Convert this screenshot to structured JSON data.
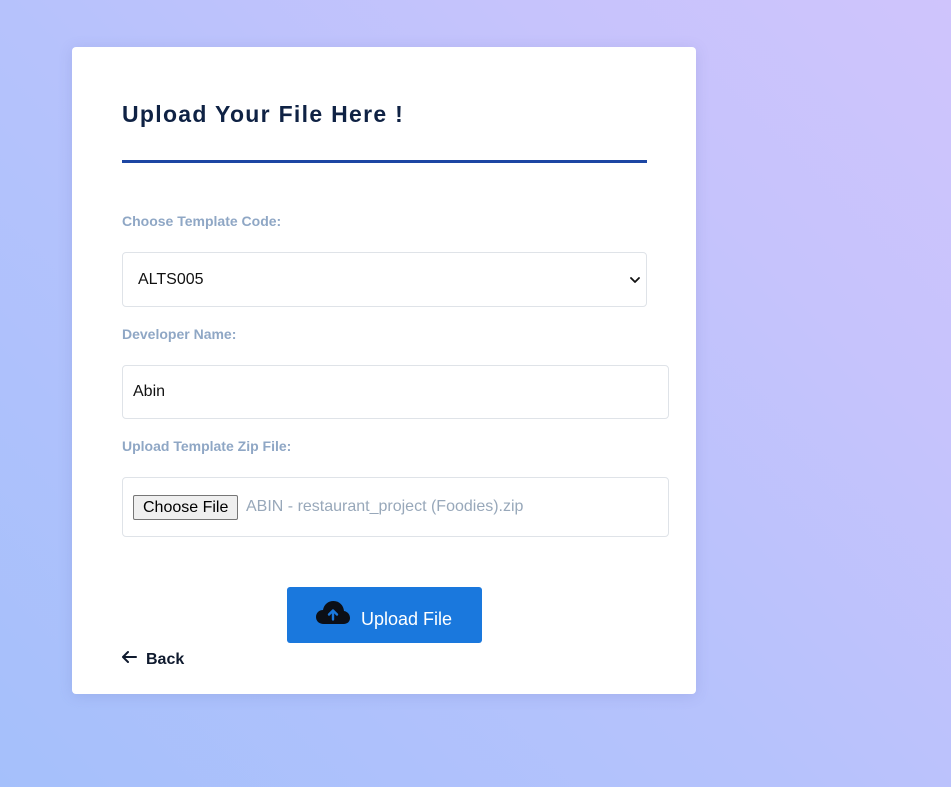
{
  "page": {
    "title": "Upload Your File Here !"
  },
  "form": {
    "template_label": "Choose Template Code:",
    "template_value": "ALTS005",
    "developer_label": "Developer Name:",
    "developer_value": "Abin",
    "zip_label": "Upload Template Zip File:",
    "choose_file_label": "Choose File",
    "chosen_file_name": "ABIN - restaurant_project (Foodies).zip",
    "upload_button_label": "Upload File",
    "upload_button_icon": "cloud-upload-icon",
    "back_label": "Back",
    "back_icon": "arrow-left-icon"
  },
  "colors": {
    "accent": "#1a78dd",
    "title": "#0f2244",
    "rule": "#1d46a3",
    "label": "#8fa7c5"
  }
}
